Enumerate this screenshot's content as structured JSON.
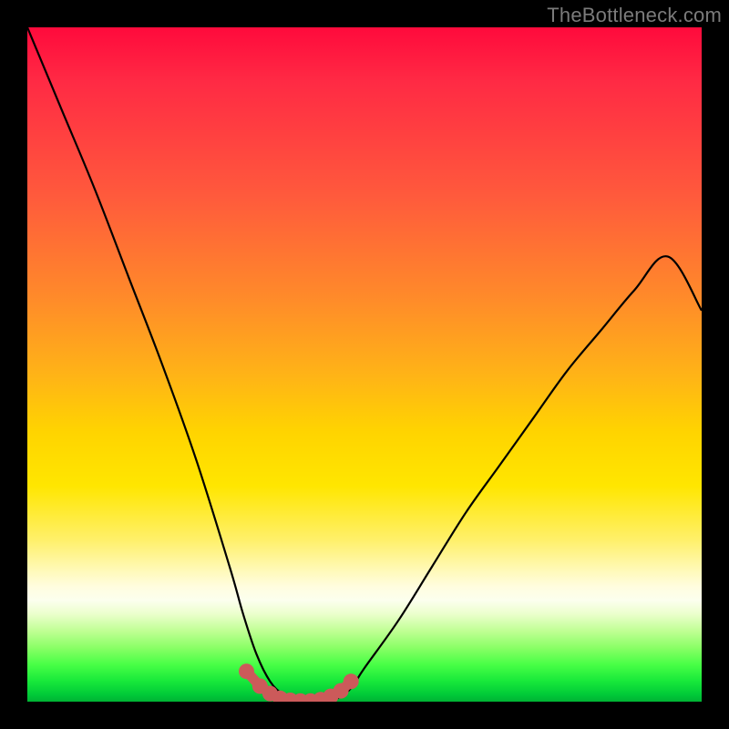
{
  "watermark": {
    "text": "TheBottleneck.com"
  },
  "colors": {
    "frame": "#000000",
    "watermark": "#7b7b7b",
    "curve_stroke": "#000000",
    "marker_stroke": "#cc5a5a",
    "marker_fill": "#cc5a5a"
  },
  "chart_data": {
    "type": "line",
    "title": "",
    "xlabel": "",
    "ylabel": "",
    "xlim": [
      0,
      100
    ],
    "ylim": [
      0,
      100
    ],
    "grid": false,
    "series": [
      {
        "name": "curve",
        "x": [
          0,
          5,
          10,
          15,
          20,
          25,
          30,
          32,
          34,
          36,
          38,
          40,
          42,
          44,
          46,
          48,
          50,
          55,
          60,
          65,
          70,
          75,
          80,
          85,
          90,
          95,
          100
        ],
        "y": [
          100,
          88,
          76,
          63,
          50,
          36,
          20,
          13,
          7,
          3,
          1,
          0,
          0,
          0,
          0.5,
          2,
          5,
          12,
          20,
          28,
          35,
          42,
          49,
          55,
          61,
          66,
          58
        ]
      }
    ],
    "highlight": {
      "name": "valley-markers",
      "x": [
        32.5,
        34.5,
        36,
        37.5,
        39,
        40.5,
        42,
        43.5,
        45,
        46.5,
        48
      ],
      "y": [
        4.5,
        2.3,
        1.2,
        0.5,
        0.2,
        0.1,
        0.1,
        0.3,
        0.8,
        1.6,
        3.0
      ]
    }
  }
}
